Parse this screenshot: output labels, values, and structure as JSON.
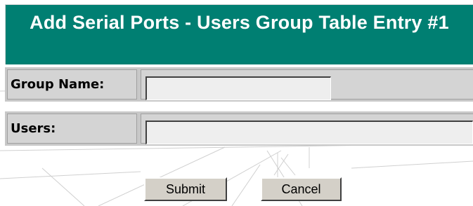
{
  "form": {
    "title": "Add Serial Ports - Users Group Table Entry #1",
    "fields": [
      {
        "label": "Group Name:",
        "value": ""
      },
      {
        "label": "Users:",
        "value": ""
      }
    ]
  },
  "buttons": {
    "submit_label": "Submit",
    "cancel_label": "Cancel"
  },
  "colors": {
    "title_background": "#007f72",
    "title_text": "#ffffff",
    "row_background": "#d4d4d4"
  }
}
